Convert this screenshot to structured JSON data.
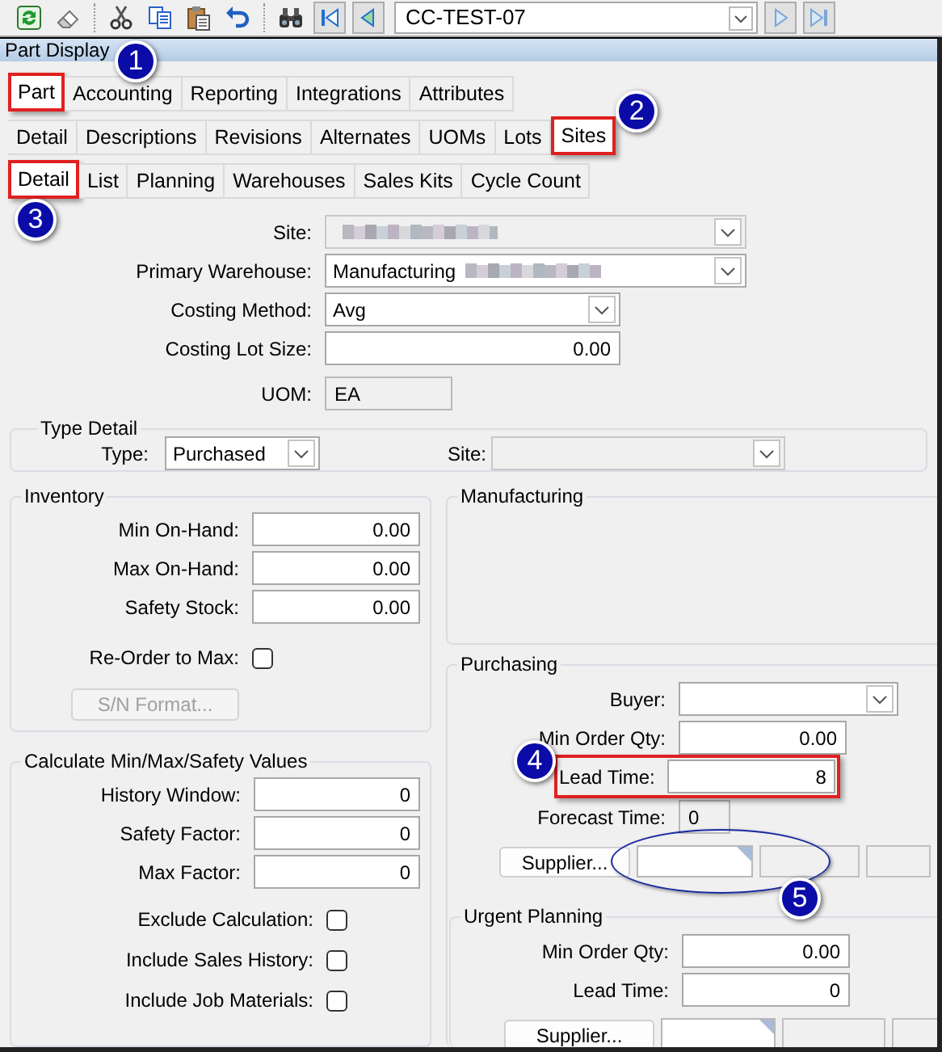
{
  "toolbar": {
    "record": "CC-TEST-07"
  },
  "title": "Part Display",
  "tabs": [
    {
      "label": "Part",
      "selected": true,
      "callout": {
        "number": "1",
        "kind": "box"
      }
    },
    {
      "label": "Accounting",
      "selected": false
    },
    {
      "label": "Reporting",
      "selected": false
    },
    {
      "label": "Integrations",
      "selected": false
    },
    {
      "label": "Attributes",
      "selected": false
    }
  ],
  "subtabs": [
    {
      "label": "Detail",
      "selected": false
    },
    {
      "label": "Descriptions",
      "selected": false
    },
    {
      "label": "Revisions",
      "selected": false
    },
    {
      "label": "Alternates",
      "selected": false
    },
    {
      "label": "UOMs",
      "selected": false
    },
    {
      "label": "Lots",
      "selected": false
    },
    {
      "label": "Sites",
      "selected": true,
      "callout": {
        "number": "2",
        "kind": "box"
      }
    }
  ],
  "site_tabs": [
    {
      "label": "Detail",
      "selected": true,
      "callout": {
        "number": "3",
        "kind": "box"
      }
    },
    {
      "label": "List",
      "selected": false
    },
    {
      "label": "Planning",
      "selected": false
    },
    {
      "label": "Warehouses",
      "selected": false
    },
    {
      "label": "Sales Kits",
      "selected": false
    },
    {
      "label": "Cycle Count",
      "selected": false
    }
  ],
  "header_fields": [
    {
      "kind": "dropdown",
      "label": "Site:",
      "blurred": true,
      "disabled": true
    },
    {
      "kind": "dropdown",
      "label": "Primary Warehouse:",
      "value": "Manufacturing",
      "blurred": true,
      "disabled": false
    },
    {
      "kind": "dropdown",
      "label": "Costing Method:",
      "value": "Avg",
      "disabled": false
    },
    {
      "kind": "text",
      "label": "Costing Lot Size:",
      "value": "0.00",
      "disabled": false
    },
    {
      "kind": "text",
      "label": "UOM:",
      "value": "EA",
      "disabled": true
    }
  ],
  "type_detail": {
    "title": "Type Detail",
    "fields": [
      {
        "kind": "dropdown",
        "label": "Type:",
        "value": "Purchased",
        "disabled": false
      },
      {
        "kind": "dropdown",
        "label": "Site:",
        "disabled": true
      }
    ]
  },
  "inventory": {
    "title": "Inventory",
    "fields": [
      {
        "kind": "text",
        "label": "Min On-Hand:",
        "value": "0.00",
        "disabled": false
      },
      {
        "kind": "text",
        "label": "Max On-Hand:",
        "value": "0.00",
        "disabled": false
      },
      {
        "kind": "text",
        "label": "Safety Stock:",
        "value": "0.00",
        "disabled": false
      },
      {
        "kind": "checkbox",
        "label": "Re-Order to Max:",
        "checked": false
      },
      {
        "kind": "button",
        "label": "S/N Format...",
        "disabled": true
      }
    ]
  },
  "calculate": {
    "title": "Calculate Min/Max/Safety Values",
    "fields": [
      {
        "kind": "text",
        "label": "History Window:",
        "value": "0",
        "disabled": false
      },
      {
        "kind": "text",
        "label": "Safety Factor:",
        "value": "0",
        "disabled": false
      },
      {
        "kind": "text",
        "label": "Max Factor:",
        "value": "0",
        "disabled": false
      },
      {
        "kind": "checkbox",
        "label": "Exclude Calculation:",
        "checked": false
      },
      {
        "kind": "checkbox",
        "label": "Include Sales History:",
        "checked": false
      },
      {
        "kind": "checkbox",
        "label": "Include Job Materials:",
        "checked": false
      }
    ]
  },
  "manufacturing": {
    "title": "Manufacturing"
  },
  "purchasing": {
    "title": "Purchasing",
    "fields": [
      {
        "kind": "dropdown",
        "label": "Buyer:",
        "disabled": false
      },
      {
        "kind": "text",
        "label": "Min Order Qty:",
        "value": "0.00",
        "disabled": false
      },
      {
        "kind": "text",
        "label": "Lead Time:",
        "value": "8",
        "disabled": false,
        "callout": {
          "number": "4",
          "kind": "box"
        }
      },
      {
        "kind": "text",
        "label": "Forecast Time:",
        "value": "0",
        "disabled": true
      },
      {
        "kind": "supplier",
        "label": "Supplier...",
        "callout": {
          "number": "5",
          "kind": "ellipse"
        }
      }
    ]
  },
  "urgent_planning": {
    "title": "Urgent Planning",
    "fields": [
      {
        "kind": "text",
        "label": "Min Order Qty:",
        "value": "0.00",
        "disabled": false
      },
      {
        "kind": "text",
        "label": "Lead Time:",
        "value": "0",
        "disabled": false
      },
      {
        "kind": "supplier",
        "label": "Supplier..."
      }
    ]
  }
}
